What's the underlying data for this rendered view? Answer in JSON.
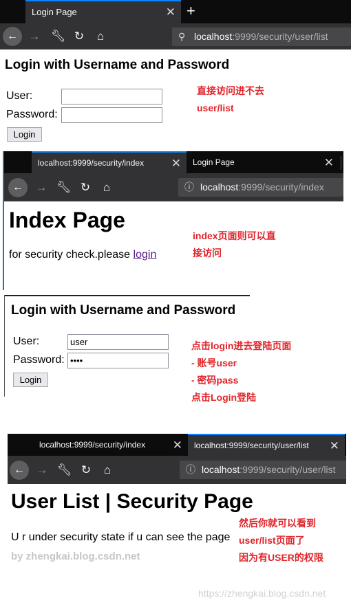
{
  "shot1": {
    "tabs": [
      {
        "label": "Login Page",
        "close": "✕"
      }
    ],
    "new_tab": "+",
    "url_host": "localhost",
    "url_path": ":9999/security/user/list",
    "heading": "Login with Username and Password",
    "user_label": "User:",
    "password_label": "Password:",
    "user_value": "",
    "password_value": "",
    "login_button": "Login",
    "note": [
      "直接访问进不去",
      "user/list"
    ]
  },
  "shot2": {
    "tabs": [
      {
        "label": "localhost:9999/security/index",
        "close": "✕"
      },
      {
        "label": "Login Page",
        "close": "✕"
      }
    ],
    "url_host": "localhost",
    "url_path": ":9999/security/index",
    "heading": "Index Page",
    "text": "for security check.please ",
    "link": "login",
    "note": [
      "index页面则可以直",
      "接访问"
    ]
  },
  "shot3": {
    "heading": "Login with Username and Password",
    "user_label": "User:",
    "password_label": "Password:",
    "user_value": "user",
    "password_value": "pass",
    "password_display": "●●●●",
    "login_button": "Login",
    "note": [
      "点击login进去登陆页面",
      "- 账号user",
      "- 密码pass",
      "点击Login登陆"
    ]
  },
  "shot4": {
    "tabs": [
      {
        "label": "localhost:9999/security/index",
        "close": "✕"
      },
      {
        "label": "localhost:9999/security/user/list",
        "close": "✕"
      }
    ],
    "url_host": "localhost",
    "url_path": ":9999/security/user/list",
    "heading": "User List | Security Page",
    "text": "U r under security state if u can see the page",
    "credit": "by zhengkai.blog.csdn.net",
    "note": [
      "然后你就可以看到",
      "user/list页面了",
      "因为有USER的权限"
    ]
  },
  "watermark": "https://zhengkai.blog.csdn.net",
  "icons": {
    "back": "left-arrow-icon",
    "forward": "right-arrow-icon",
    "tools": "wrench-icon",
    "reload": "reload-icon",
    "home": "home-icon",
    "search": "search-icon",
    "info": "info-icon",
    "close": "close-icon",
    "new_tab": "plus-icon"
  },
  "colors": {
    "tab_bar": "#0c0c0d",
    "toolbar": "#323234",
    "active_tab_line": "#0a84ff",
    "note_red": "#e0242a",
    "link": "#551a8b",
    "credit_gray": "#c7c7c7"
  }
}
